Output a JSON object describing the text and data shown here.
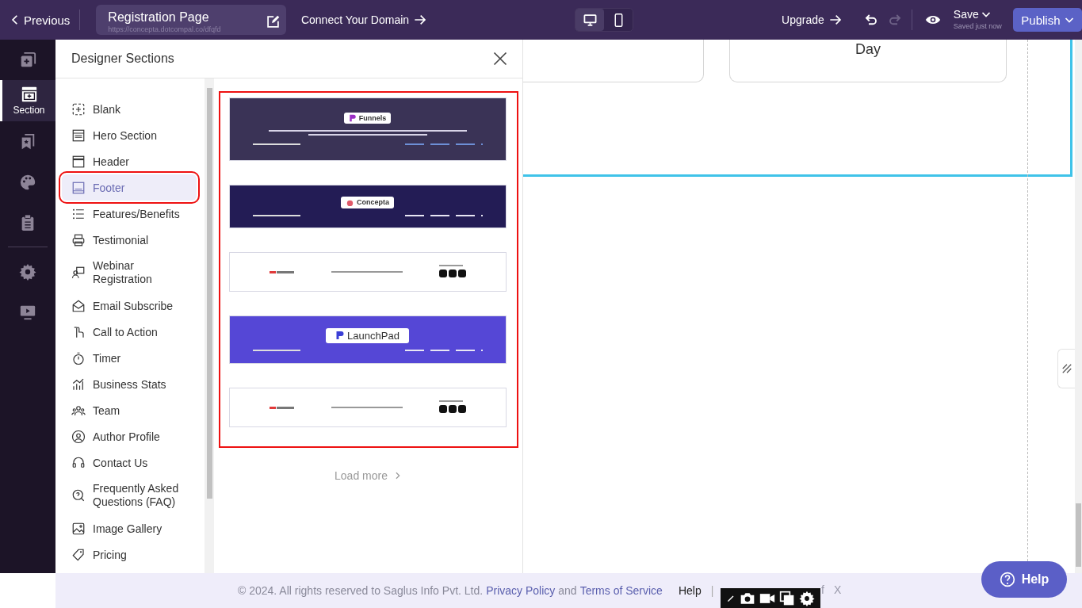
{
  "topbar": {
    "back": "Previous",
    "page_title": "Registration Page",
    "page_url": "https://concepta.dotcompal.co/dfqfd",
    "connect": "Connect Your Domain",
    "devices": [
      {
        "kind": "desktop",
        "selected": true
      },
      {
        "kind": "mobile",
        "selected": false
      }
    ],
    "upgrade": "Upgrade",
    "redo_disabled": true,
    "save": "Save",
    "save_status": "Saved just now",
    "publish": "Publish"
  },
  "rail": [
    {
      "kind": "pages",
      "selected": false
    },
    {
      "kind": "section",
      "label": "Section",
      "selected": true
    },
    {
      "kind": "saved",
      "selected": false
    },
    {
      "kind": "theme",
      "selected": false
    },
    {
      "kind": "forms",
      "selected": false
    },
    {
      "kind": "settings",
      "selected": false
    },
    {
      "kind": "preview",
      "selected": false
    }
  ],
  "panel": {
    "title": "Designer Sections",
    "categories": [
      {
        "kind": "blank",
        "label": "Blank",
        "selected": false,
        "highlighted": false
      },
      {
        "kind": "hero",
        "label": "Hero Section",
        "selected": false,
        "highlighted": false
      },
      {
        "kind": "header",
        "label": "Header",
        "selected": false,
        "highlighted": false
      },
      {
        "kind": "footer",
        "label": "Footer",
        "selected": true,
        "highlighted": true
      },
      {
        "kind": "list",
        "label": "Features/Benefits",
        "selected": false,
        "highlighted": false
      },
      {
        "kind": "testimonial",
        "label": "Testimonial",
        "selected": false,
        "highlighted": false
      },
      {
        "kind": "webinar",
        "label": "Webinar Registration",
        "selected": false,
        "highlighted": false
      },
      {
        "kind": "email",
        "label": "Email Subscribe",
        "selected": false,
        "highlighted": false
      },
      {
        "kind": "cta",
        "label": "Call to Action",
        "selected": false,
        "highlighted": false
      },
      {
        "kind": "timer",
        "label": "Timer",
        "selected": false,
        "highlighted": false
      },
      {
        "kind": "stats",
        "label": "Business Stats",
        "selected": false,
        "highlighted": false
      },
      {
        "kind": "team",
        "label": "Team",
        "selected": false,
        "highlighted": false
      },
      {
        "kind": "author",
        "label": "Author Profile",
        "selected": false,
        "highlighted": false
      },
      {
        "kind": "contact",
        "label": "Contact Us",
        "selected": false,
        "highlighted": false
      },
      {
        "kind": "faq",
        "label": "Frequently Asked Questions (FAQ)",
        "selected": false,
        "highlighted": false
      },
      {
        "kind": "gallery",
        "label": "Image Gallery",
        "selected": false,
        "highlighted": false
      },
      {
        "kind": "pricing",
        "label": "Pricing",
        "selected": false,
        "highlighted": false
      }
    ],
    "templates_highlighted": true,
    "templates": [
      {
        "kind": "dark-note",
        "logo": "Funnels"
      },
      {
        "kind": "navy",
        "logo": "Concepta"
      },
      {
        "kind": "light-social"
      },
      {
        "kind": "violet",
        "logo": "LaunchPad"
      },
      {
        "kind": "light-social"
      }
    ],
    "load_more": "Load more"
  },
  "canvas": {
    "card_text": "Day"
  },
  "footer": {
    "copyright": "©  2024. All rights reserved to Saglus Info Pvt. Ltd.",
    "privacy": "Privacy Policy",
    "and": "and",
    "terms": "Terms of Service",
    "help": "Help",
    "separator": "|",
    "social": [
      "f",
      "X"
    ]
  },
  "recorder": {
    "tools": [
      {
        "kind": "pen"
      },
      {
        "kind": "camera"
      },
      {
        "kind": "video"
      },
      {
        "kind": "windows"
      },
      {
        "kind": "settings"
      }
    ]
  },
  "help_button": "Help"
}
